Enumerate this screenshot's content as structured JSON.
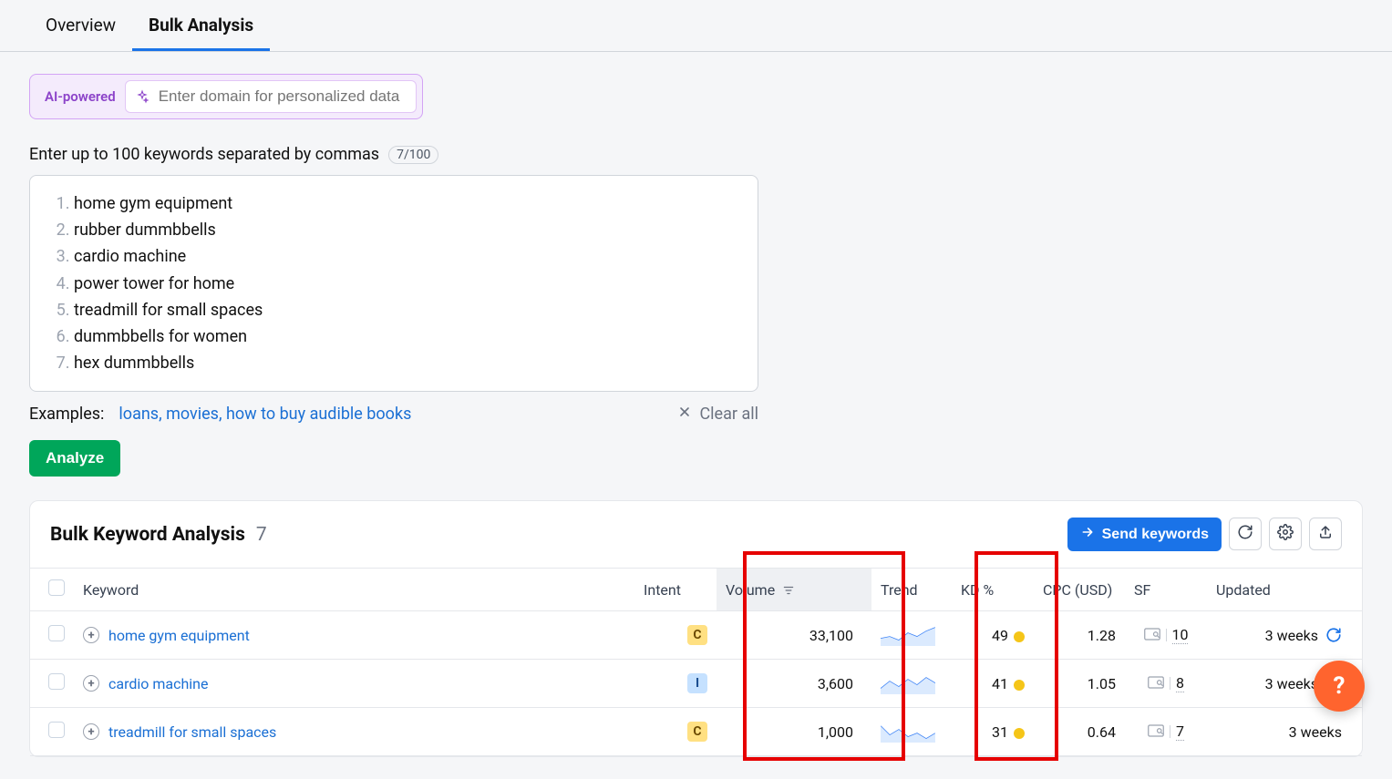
{
  "tabs": {
    "overview": "Overview",
    "bulk": "Bulk Analysis"
  },
  "ai": {
    "label": "AI-powered",
    "placeholder": "Enter domain for personalized data"
  },
  "keywords": {
    "header": "Enter up to 100 keywords separated by commas",
    "counter": "7/100",
    "items": [
      "home gym equipment",
      "rubber dummbbells",
      "cardio machine",
      "power tower for home",
      "treadmill for small spaces",
      "dummbbells for women",
      "hex dummbbells"
    ],
    "examples_label": "Examples:",
    "examples_links": "loans, movies, how to buy audible books",
    "clear_all": "Clear all",
    "analyze": "Analyze"
  },
  "results": {
    "title": "Bulk Keyword Analysis",
    "count": "7",
    "send_label": "Send keywords",
    "columns": {
      "keyword": "Keyword",
      "intent": "Intent",
      "volume": "Volume",
      "trend": "Trend",
      "kd": "KD %",
      "cpc": "CPC (USD)",
      "sf": "SF",
      "updated": "Updated"
    },
    "rows": [
      {
        "keyword": "home gym equipment",
        "intent": "C",
        "volume": "33,100",
        "kd": "49",
        "cpc": "1.28",
        "sf": "10",
        "updated": "3 weeks",
        "refresh": true
      },
      {
        "keyword": "cardio machine",
        "intent": "I",
        "volume": "3,600",
        "kd": "41",
        "cpc": "1.05",
        "sf": "8",
        "updated": "3 weeks",
        "refresh": true
      },
      {
        "keyword": "treadmill for small spaces",
        "intent": "C",
        "volume": "1,000",
        "kd": "31",
        "cpc": "0.64",
        "sf": "7",
        "updated": "3 weeks",
        "refresh": false
      }
    ]
  },
  "fab": "?"
}
